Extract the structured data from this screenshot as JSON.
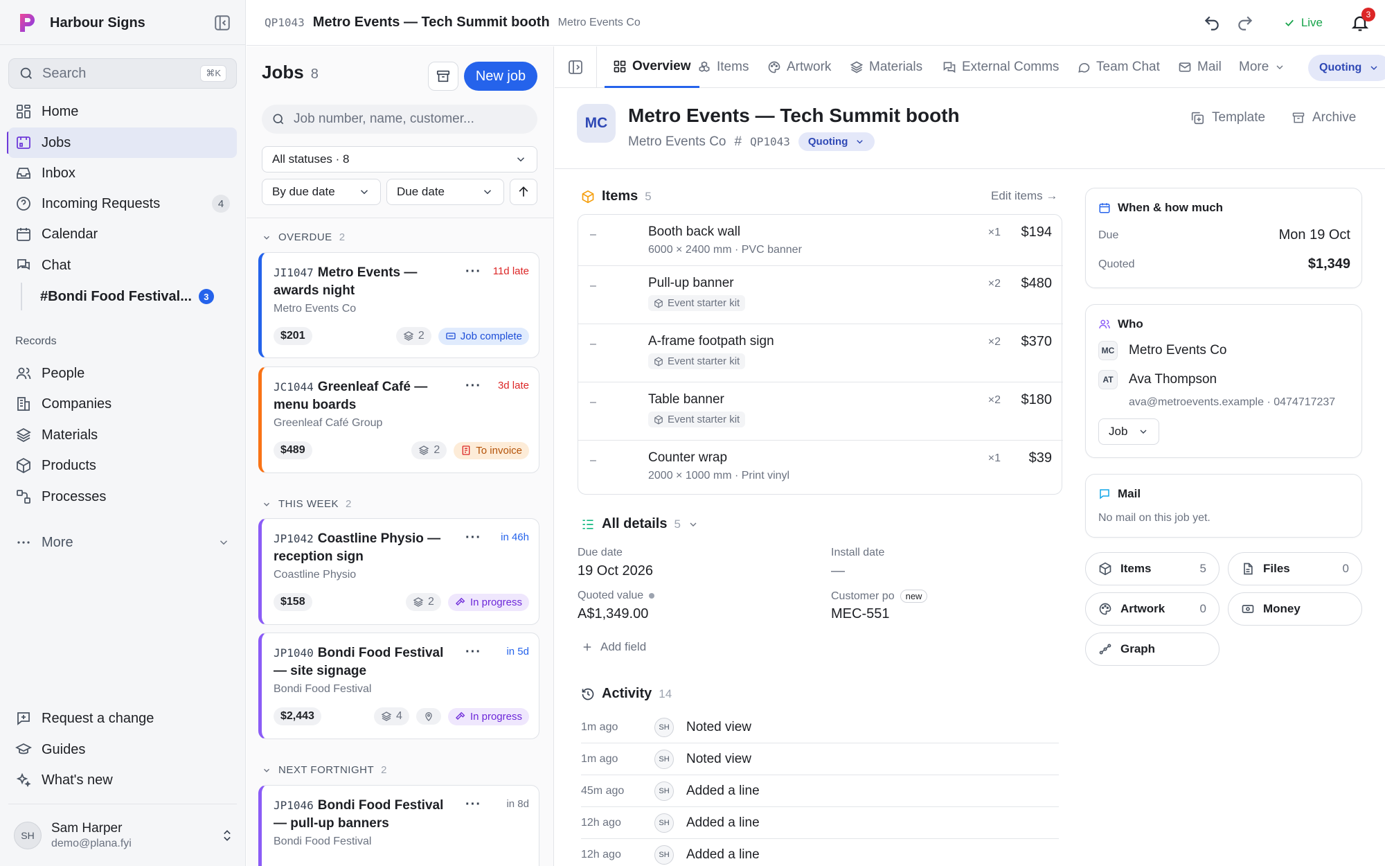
{
  "app": {
    "name": "Harbour Signs"
  },
  "sidebar": {
    "search_label": "Search",
    "search_shortcut": "⌘K",
    "items": [
      {
        "label": "Home",
        "icon": "home-icon"
      },
      {
        "label": "Jobs",
        "icon": "jobs-icon"
      },
      {
        "label": "Inbox",
        "icon": "inbox-icon"
      },
      {
        "label": "Incoming Requests",
        "icon": "question-icon",
        "count": "4"
      },
      {
        "label": "Calendar",
        "icon": "calendar-icon"
      },
      {
        "label": "Chat",
        "icon": "chat-icon"
      }
    ],
    "channel": {
      "label": "#Bondi Food Festival...",
      "count": "3"
    },
    "records_title": "Records",
    "records": [
      {
        "label": "People"
      },
      {
        "label": "Companies"
      },
      {
        "label": "Materials"
      },
      {
        "label": "Products"
      },
      {
        "label": "Processes"
      }
    ],
    "more_label": "More",
    "footer_items": [
      {
        "label": "Request a change"
      },
      {
        "label": "Guides"
      },
      {
        "label": "What's new"
      }
    ],
    "user": {
      "initials": "SH",
      "name": "Sam Harper",
      "email": "demo@plana.fyi"
    }
  },
  "topbar": {
    "code": "QP1043",
    "title": "Metro Events — Tech Summit booth",
    "company": "Metro Events Co",
    "live_label": "Live",
    "notifications": "3"
  },
  "jobs": {
    "title": "Jobs",
    "count": "8",
    "new_job_label": "New job",
    "search_placeholder": "Job number, name, customer...",
    "filter_status": "All statuses · 8",
    "group_by": "By due date",
    "sort_field": "Due date",
    "groups": [
      {
        "label": "OVERDUE",
        "count": "2"
      },
      {
        "label": "THIS WEEK",
        "count": "2"
      },
      {
        "label": "NEXT FORTNIGHT",
        "count": "2"
      }
    ],
    "cards": [
      {
        "code": "JI1047",
        "title": "Metro Events — awards night",
        "customer": "Metro Events Co",
        "due": "11d late",
        "price": "$201",
        "layers": "2",
        "status": "Job complete",
        "accent": "#2563eb"
      },
      {
        "code": "JC1044",
        "title": "Greenleaf Café — menu boards",
        "customer": "Greenleaf Café Group",
        "due": "3d late",
        "price": "$489",
        "layers": "2",
        "status": "To invoice",
        "accent": "#f97316"
      },
      {
        "code": "JP1042",
        "title": "Coastline Physio — reception sign",
        "customer": "Coastline Physio",
        "due": "in 46h",
        "price": "$158",
        "layers": "2",
        "status": "In progress",
        "accent": "#8b5cf6"
      },
      {
        "code": "JP1040",
        "title": "Bondi Food Festival — site signage",
        "customer": "Bondi Food Festival",
        "due": "in 5d",
        "price": "$2,443",
        "layers": "4",
        "status": "In progress",
        "accent": "#8b5cf6"
      },
      {
        "code": "JP1046",
        "title": "Bondi Food Festival — pull-up banners",
        "customer": "Bondi Food Festival",
        "due": "in 8d",
        "price": "",
        "layers": "",
        "status": "",
        "accent": "#8b5cf6"
      }
    ]
  },
  "tabs": [
    {
      "label": "Overview",
      "active": true
    },
    {
      "label": "Items"
    },
    {
      "label": "Artwork"
    },
    {
      "label": "Materials"
    },
    {
      "label": "External Comms"
    },
    {
      "label": "Team Chat"
    },
    {
      "label": "Mail"
    },
    {
      "label": "More"
    }
  ],
  "stage_pill": "Quoting",
  "detail": {
    "initials": "MC",
    "title": "Metro Events — Tech Summit booth",
    "company": "Metro Events Co",
    "code": "QP1043",
    "stage": "Quoting",
    "template_label": "Template",
    "archive_label": "Archive",
    "items_title": "Items",
    "items_count": "5",
    "edit_items_label": "Edit items →",
    "items": [
      {
        "name": "Booth back wall",
        "meta": "6000 × 2400 mm · PVC banner",
        "kit": "",
        "qty": "×1",
        "price": "$194"
      },
      {
        "name": "Pull-up banner",
        "meta": "",
        "kit": "Event starter kit",
        "qty": "×2",
        "price": "$480"
      },
      {
        "name": "A-frame footpath sign",
        "meta": "",
        "kit": "Event starter kit",
        "qty": "×2",
        "price": "$370"
      },
      {
        "name": "Table banner",
        "meta": "",
        "kit": "Event starter kit",
        "qty": "×2",
        "price": "$180"
      },
      {
        "name": "Counter wrap",
        "meta": "2000 × 1000 mm · Print vinyl",
        "kit": "",
        "qty": "×1",
        "price": "$39"
      }
    ],
    "all_details_title": "All details",
    "all_details_count": "5",
    "fields": {
      "due_label": "Due date",
      "due_value": "19 Oct 2026",
      "install_label": "Install date",
      "install_value": "—",
      "quoted_label": "Quoted value",
      "quoted_value": "A$1,349.00",
      "po_label": "Customer po",
      "po_tag": "new",
      "po_value": "MEC-551"
    },
    "add_field_label": "Add field",
    "activity_title": "Activity",
    "activity_count": "14",
    "activity": [
      {
        "time": "1m ago",
        "user": "SH",
        "text": "Noted view"
      },
      {
        "time": "1m ago",
        "user": "SH",
        "text": "Noted view"
      },
      {
        "time": "45m ago",
        "user": "SH",
        "text": "Added a line"
      },
      {
        "time": "12h ago",
        "user": "SH",
        "text": "Added a line"
      },
      {
        "time": "12h ago",
        "user": "SH",
        "text": "Added a line"
      }
    ]
  },
  "right": {
    "when_title": "When & how much",
    "due_key": "Due",
    "due_val": "Mon 19 Oct",
    "quoted_key": "Quoted",
    "quoted_val": "$1,349",
    "who_title": "Who",
    "company_initials": "MC",
    "company": "Metro Events Co",
    "contact_initials": "AT",
    "contact": "Ava Thompson",
    "contact_detail": "ava@metroevents.example · 0474717237",
    "job_select": "Job",
    "mail_title": "Mail",
    "mail_empty": "No mail on this job yet.",
    "quick": [
      {
        "label": "Items",
        "count": "5"
      },
      {
        "label": "Files",
        "count": "0"
      },
      {
        "label": "Artwork",
        "count": "0"
      },
      {
        "label": "Money",
        "count": ""
      },
      {
        "label": "Graph",
        "count": ""
      }
    ]
  }
}
